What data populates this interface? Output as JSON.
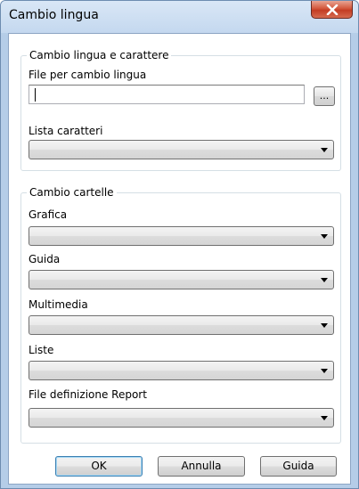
{
  "window": {
    "title": "Cambio lingua"
  },
  "language_group": {
    "legend": "Cambio lingua e carattere",
    "file_label": "File per cambio lingua",
    "file_value": "",
    "browse_label": "...",
    "charset_label": "Lista caratteri",
    "charset_value": ""
  },
  "folders_group": {
    "legend": "Cambio cartelle",
    "fields": [
      {
        "label": "Grafica",
        "value": ""
      },
      {
        "label": "Guida",
        "value": ""
      },
      {
        "label": "Multimedia",
        "value": ""
      },
      {
        "label": "Liste",
        "value": ""
      },
      {
        "label": "File definizione Report",
        "value": ""
      }
    ]
  },
  "buttons": {
    "ok": "OK",
    "cancel": "Annulla",
    "help": "Guida"
  },
  "icons": {
    "close": "close-icon",
    "dropdown": "chevron-down-icon"
  },
  "colors": {
    "titlebar": "#c4d8ef",
    "close_button": "#c33d24",
    "default_button_border": "#3c7fb1"
  }
}
